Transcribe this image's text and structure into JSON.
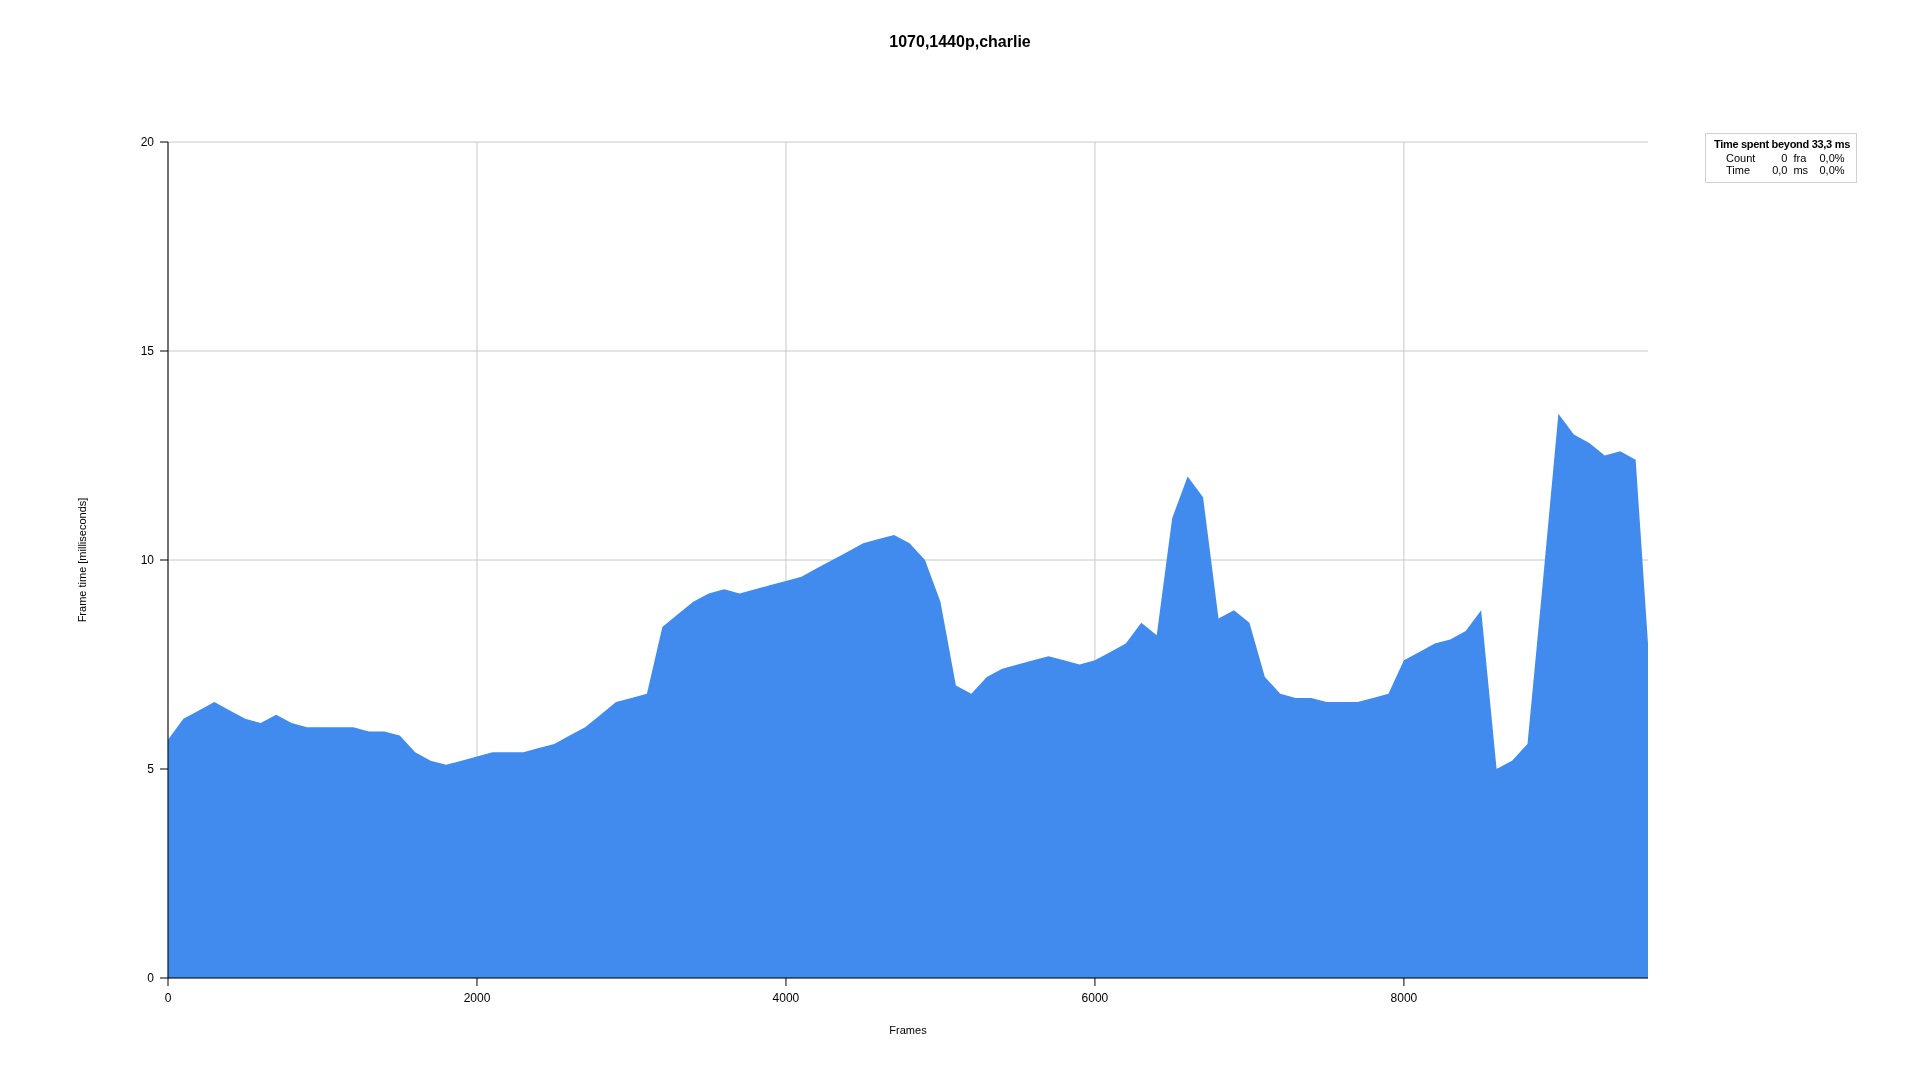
{
  "chart_data": {
    "type": "area",
    "title": "1070,1440p,charlie",
    "xlabel": "Frames",
    "ylabel": "Frame time [milliseconds]",
    "xlim": [
      0,
      9580
    ],
    "ylim": [
      0,
      20
    ],
    "xticks": [
      0,
      2000,
      4000,
      6000,
      8000
    ],
    "yticks": [
      0,
      5,
      10,
      15,
      20
    ],
    "x": [
      0,
      100,
      200,
      300,
      400,
      500,
      600,
      700,
      800,
      900,
      1000,
      1100,
      1200,
      1300,
      1400,
      1500,
      1600,
      1700,
      1800,
      1900,
      2000,
      2100,
      2200,
      2300,
      2400,
      2500,
      2600,
      2700,
      2800,
      2900,
      3000,
      3100,
      3200,
      3300,
      3400,
      3500,
      3600,
      3700,
      3800,
      3900,
      4000,
      4100,
      4200,
      4300,
      4400,
      4500,
      4600,
      4700,
      4800,
      4900,
      5000,
      5100,
      5200,
      5300,
      5400,
      5500,
      5600,
      5700,
      5800,
      5900,
      6000,
      6100,
      6200,
      6300,
      6400,
      6500,
      6600,
      6700,
      6800,
      6900,
      7000,
      7100,
      7200,
      7300,
      7400,
      7500,
      7600,
      7700,
      7800,
      7900,
      8000,
      8100,
      8200,
      8300,
      8400,
      8500,
      8600,
      8700,
      8800,
      8900,
      9000,
      9100,
      9200,
      9300,
      9400,
      9500,
      9580
    ],
    "grid": true,
    "series": [
      {
        "color": "#418bee",
        "values": [
          5.7,
          6.2,
          6.4,
          6.6,
          6.4,
          6.2,
          6.1,
          6.3,
          6.1,
          6.0,
          6.0,
          6.0,
          6.0,
          5.9,
          5.9,
          5.8,
          5.4,
          5.2,
          5.1,
          5.2,
          5.3,
          5.4,
          5.4,
          5.4,
          5.5,
          5.6,
          5.8,
          6.0,
          6.3,
          6.6,
          6.7,
          6.8,
          8.4,
          8.7,
          9.0,
          9.2,
          9.3,
          9.2,
          9.3,
          9.4,
          9.5,
          9.6,
          9.8,
          10.0,
          10.2,
          10.4,
          10.5,
          10.6,
          10.4,
          10.0,
          9.0,
          7.0,
          6.8,
          7.2,
          7.4,
          7.5,
          7.6,
          7.7,
          7.6,
          7.5,
          7.6,
          7.8,
          8.0,
          8.5,
          8.2,
          11.0,
          12.0,
          11.5,
          8.6,
          8.8,
          8.5,
          7.2,
          6.8,
          6.7,
          6.7,
          6.6,
          6.6,
          6.6,
          6.7,
          6.8,
          7.6,
          7.8,
          8.0,
          8.1,
          8.3,
          8.8,
          5.0,
          5.2,
          5.6,
          9.5,
          13.5,
          13.0,
          12.8,
          12.5,
          12.6,
          12.4,
          8.0
        ]
      }
    ]
  },
  "legend": {
    "title": "Time spent beyond 33,3 ms",
    "rows": [
      {
        "label": "Count",
        "value": "0",
        "unit": "fra",
        "percent": "0,0%"
      },
      {
        "label": "Time",
        "value": "0,0",
        "unit": "ms",
        "percent": "0,0%"
      }
    ]
  }
}
